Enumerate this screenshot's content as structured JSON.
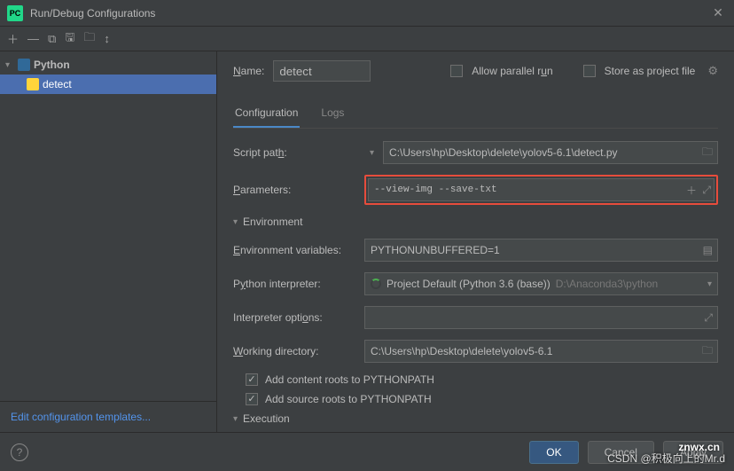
{
  "window": {
    "title": "Run/Debug Configurations"
  },
  "toolbar_icons": {
    "add": "＋",
    "remove": "—",
    "copy": "⧉",
    "save": "🖫",
    "folder": "🗀",
    "sort": "↕"
  },
  "sidebar": {
    "root": "Python",
    "items": [
      {
        "label": "detect"
      }
    ],
    "edit_link": "Edit configuration templates..."
  },
  "header": {
    "name_label": "Name:",
    "name_value": "detect",
    "parallel_label": "Allow parallel run",
    "store_label": "Store as project file"
  },
  "tabs": [
    {
      "label": "Configuration",
      "active": true
    },
    {
      "label": "Logs",
      "active": false
    }
  ],
  "form": {
    "script_path_label": "Script path:",
    "script_path_value": "C:\\Users\\hp\\Desktop\\delete\\yolov5-6.1\\detect.py",
    "parameters_label": "Parameters:",
    "parameters_value": "--view-img --save-txt",
    "env_header": "Environment",
    "env_vars_label": "Environment variables:",
    "env_vars_value": "PYTHONUNBUFFERED=1",
    "interpreter_label": "Python interpreter:",
    "interpreter_value": "Project Default (Python 3.6 (base))",
    "interpreter_path": "D:\\Anaconda3\\python",
    "interp_opts_label": "Interpreter options:",
    "interp_opts_value": "",
    "working_dir_label": "Working directory:",
    "working_dir_value": "C:\\Users\\hp\\Desktop\\delete\\yolov5-6.1",
    "add_content_roots": "Add content roots to PYTHONPATH",
    "add_source_roots": "Add source roots to PYTHONPATH",
    "execution_header": "Execution"
  },
  "footer": {
    "ok": "OK",
    "cancel": "Cancel",
    "apply": "Apply"
  },
  "watermark": {
    "line1": "znwx.cn",
    "line2": "CSDN @积极向上的Mr.d"
  }
}
